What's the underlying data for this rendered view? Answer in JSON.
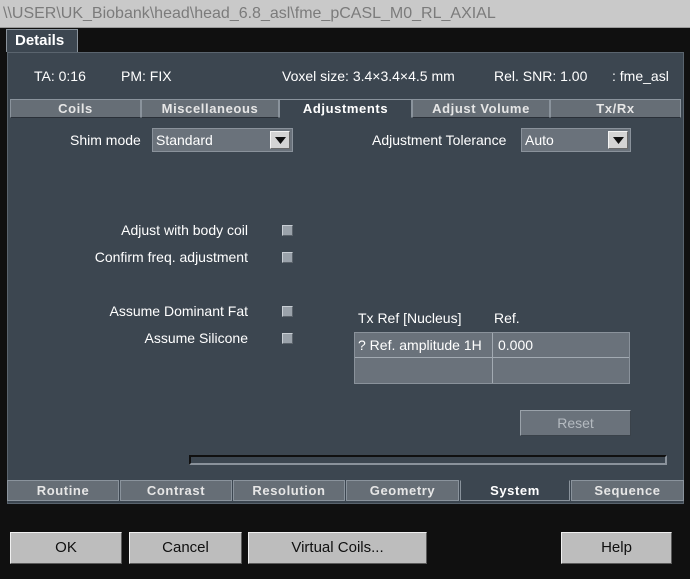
{
  "window": {
    "title": "\\\\USER\\UK_Biobank\\head\\head_6.8_asl\\fme_pCASL_M0_RL_AXIAL"
  },
  "details_tab": {
    "label": "Details"
  },
  "info_bar": {
    "ta": "TA: 0:16",
    "pm": "PM: FIX",
    "voxel": "Voxel size: 3.4×3.4×4.5 mm",
    "snr": "Rel. SNR: 1.00",
    "sequence": ": fme_asl"
  },
  "sub_tabs": [
    {
      "label": "Coils",
      "active": false
    },
    {
      "label": "Miscellaneous",
      "active": false
    },
    {
      "label": "Adjustments",
      "active": true
    },
    {
      "label": "Adjust Volume",
      "active": false
    },
    {
      "label": "Tx/Rx",
      "active": false
    }
  ],
  "adjustments": {
    "shim_mode_label": "Shim mode",
    "shim_mode_value": "Standard",
    "tolerance_label": "Adjustment Tolerance",
    "tolerance_value": "Auto",
    "adjust_body_coil_label": "Adjust with body coil",
    "adjust_body_coil_checked": false,
    "confirm_freq_label": "Confirm freq. adjustment",
    "confirm_freq_checked": false,
    "dominant_fat_label": "Assume Dominant Fat",
    "dominant_fat_checked": false,
    "silicone_label": "Assume Silicone",
    "silicone_checked": false,
    "reset_label": "Reset"
  },
  "ref_table": {
    "headers": [
      "Tx Ref [Nucleus]",
      "Ref."
    ],
    "rows": [
      [
        "? Ref. amplitude 1H",
        "0.000"
      ],
      [
        "",
        ""
      ]
    ]
  },
  "bottom_tabs": [
    {
      "label": "Routine",
      "active": false
    },
    {
      "label": "Contrast",
      "active": false
    },
    {
      "label": "Resolution",
      "active": false
    },
    {
      "label": "Geometry",
      "active": false
    },
    {
      "label": "System",
      "active": true
    },
    {
      "label": "Sequence",
      "active": false
    }
  ],
  "footer": {
    "ok": "OK",
    "cancel": "Cancel",
    "virtual_coils": "Virtual Coils...",
    "help": "Help"
  },
  "colors": {
    "panel": "#3c4650",
    "field": "#6a727b",
    "dark": "#101010"
  }
}
